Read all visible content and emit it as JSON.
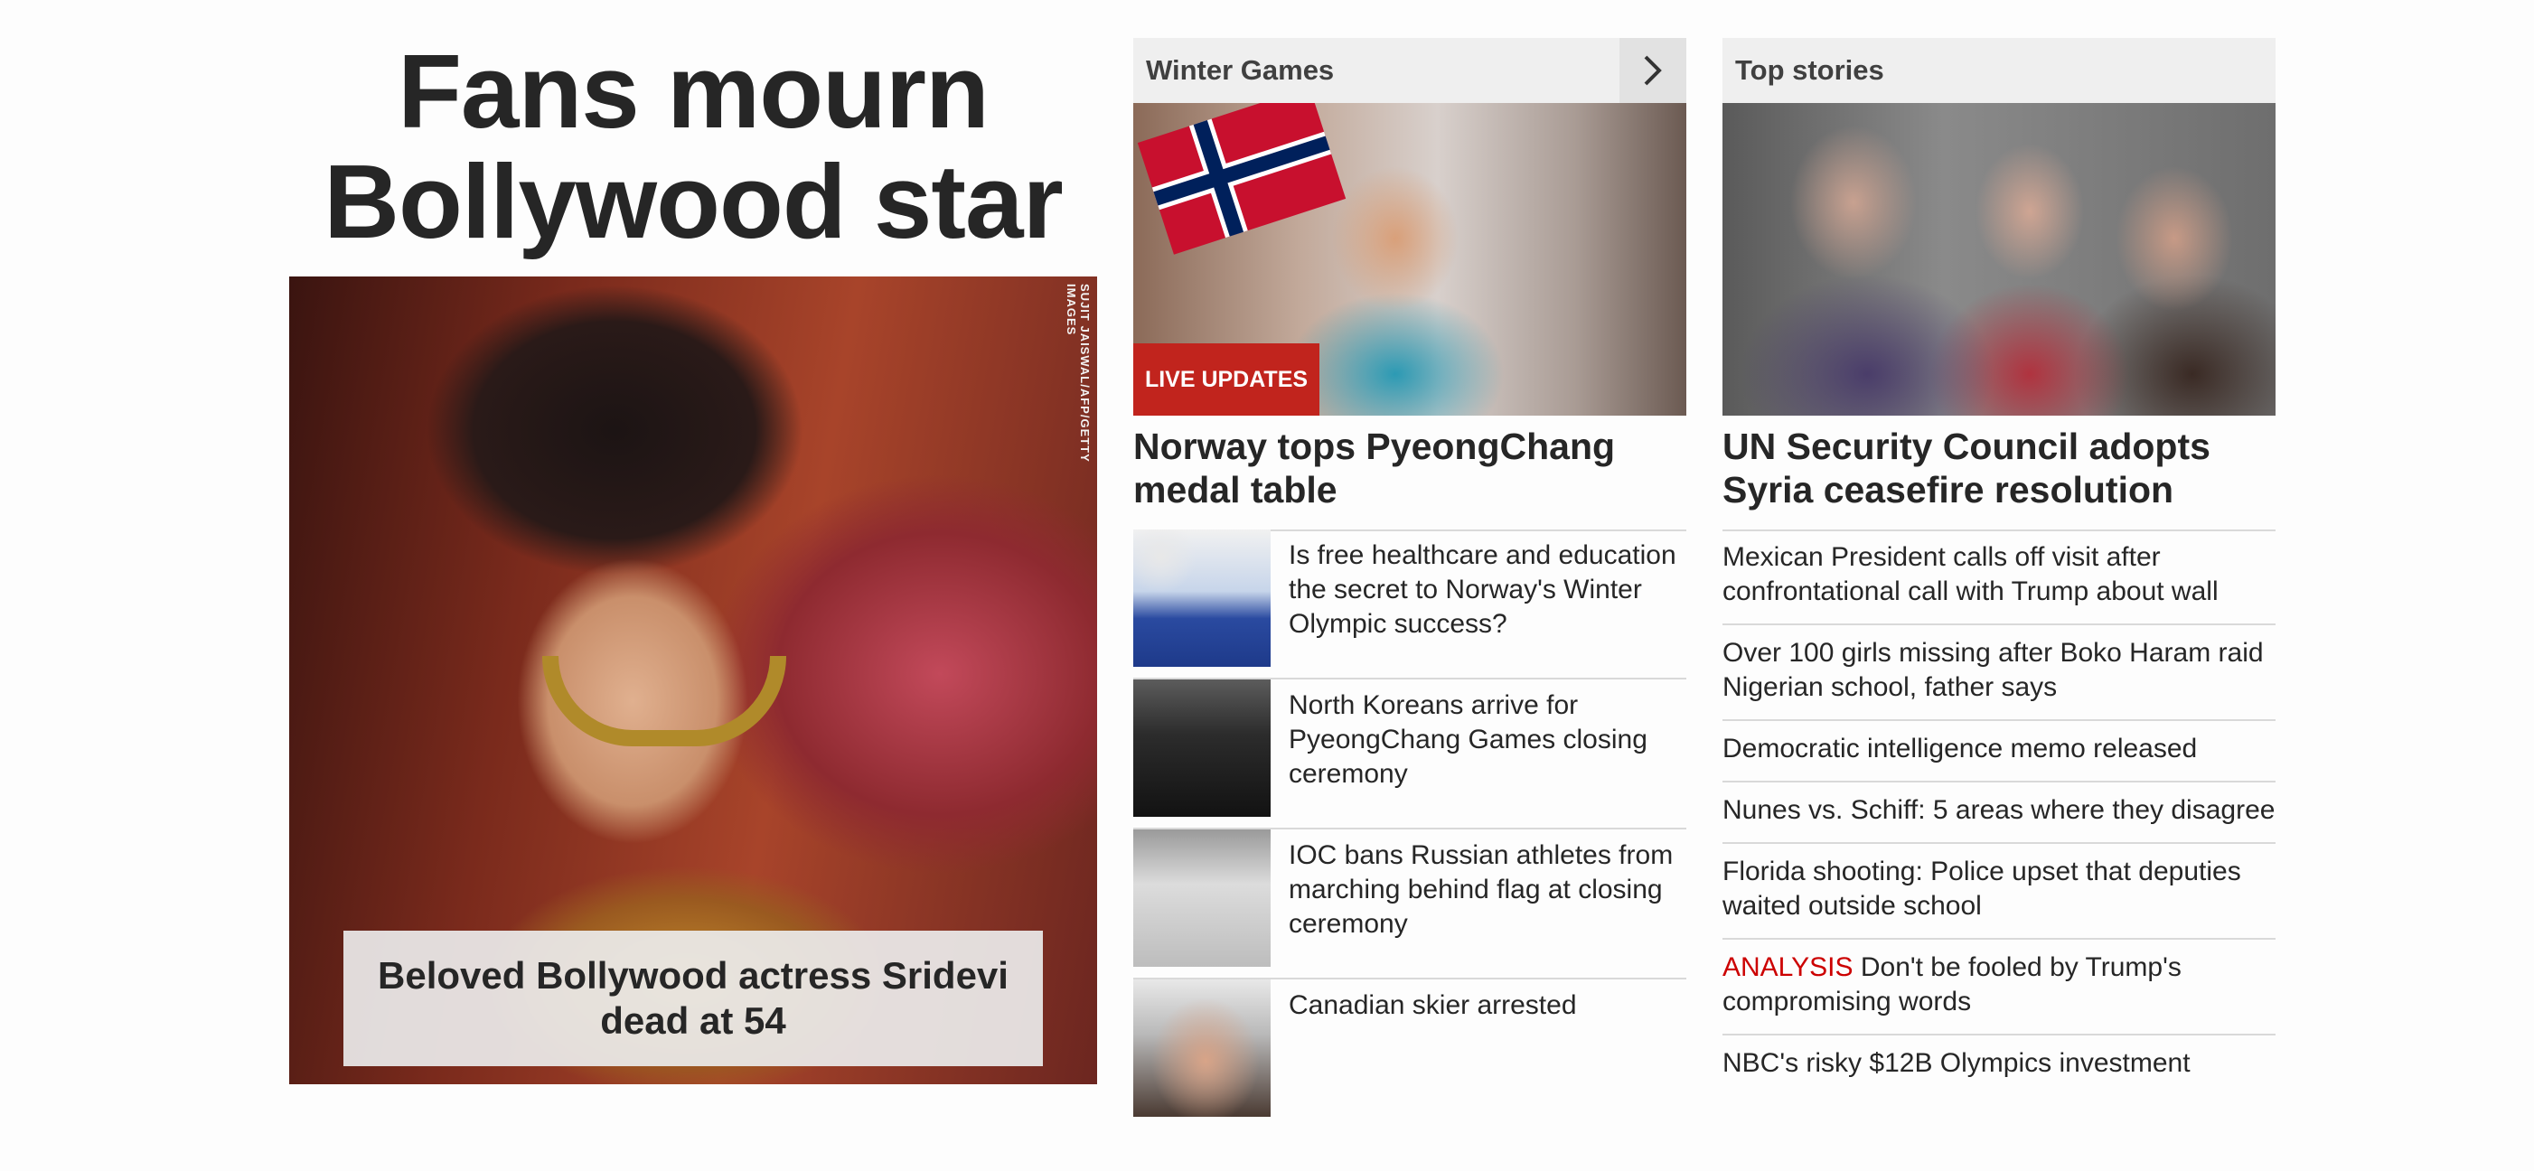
{
  "hero": {
    "headline": "Fans mourn Bollywood star",
    "image_credit": "SUJIT JAISWAL/AFP/GETTY IMAGES",
    "caption": "Beloved Bollywood actress Sridevi dead at 54"
  },
  "winter_games": {
    "section_title": "Winter Games",
    "next_icon": "chevron-right-icon",
    "live_badge": "LIVE UPDATES",
    "headline": "Norway tops PyeongChang medal table",
    "items": [
      {
        "text": "Is free healthcare and education the secret to Norway's Winter Olympic success?"
      },
      {
        "text": "North Koreans arrive for PyeongChang Games closing ceremony"
      },
      {
        "text": "IOC bans Russian athletes from marching behind flag at closing ceremony"
      },
      {
        "text": "Canadian skier arrested"
      }
    ]
  },
  "top_stories": {
    "section_title": "Top stories",
    "headline": "UN Security Council adopts Syria ceasefire resolution",
    "items": [
      {
        "tag": "",
        "text": "Mexican President calls off visit after confrontational call with Trump about wall"
      },
      {
        "tag": "",
        "text": "Over 100 girls missing after Boko Haram raid Nigerian school, father says"
      },
      {
        "tag": "",
        "text": "Democratic intelligence memo released"
      },
      {
        "tag": "",
        "text": "Nunes vs. Schiff: 5 areas where they disagree"
      },
      {
        "tag": "",
        "text": "Florida shooting: Police upset that deputies waited outside school"
      },
      {
        "tag": "ANALYSIS",
        "text": "Don't be fooled by Trump's compromising words"
      },
      {
        "tag": "",
        "text": "NBC's risky $12B Olympics investment"
      }
    ]
  },
  "colors": {
    "live_badge": "#c1241d",
    "analysis_tag": "#cc0000",
    "section_header_bg": "#efefef"
  }
}
